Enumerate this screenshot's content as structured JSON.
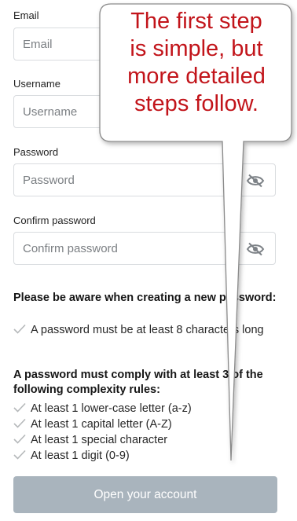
{
  "form": {
    "email": {
      "label": "Email",
      "placeholder": "Email"
    },
    "username": {
      "label": "Username",
      "placeholder": "Username"
    },
    "password": {
      "label": "Password",
      "placeholder": "Password",
      "toggle_icon": "eye-slash-icon"
    },
    "confirm_password": {
      "label": "Confirm password",
      "placeholder": "Confirm password",
      "toggle_icon": "eye-slash-icon"
    }
  },
  "notice": {
    "title": "Please be aware when creating a new password:",
    "rules": [
      "A password must be at least 8 characters long"
    ]
  },
  "complexity": {
    "title": "A password must comply with at least 3 of the following complexity rules:",
    "rules": [
      "At least 1 lower-case letter (a-z)",
      "At least 1 capital letter (A-Z)",
      "At least 1 special character",
      "At least 1 digit (0-9)"
    ]
  },
  "submit_label": "Open your account",
  "callout": {
    "lines": [
      "The first step",
      "is simple, but",
      "more detailed",
      "steps follow."
    ]
  },
  "colors": {
    "callout_text": "#c2141a",
    "button_bg": "#a9b4bd",
    "check": "#b5b8ba"
  }
}
